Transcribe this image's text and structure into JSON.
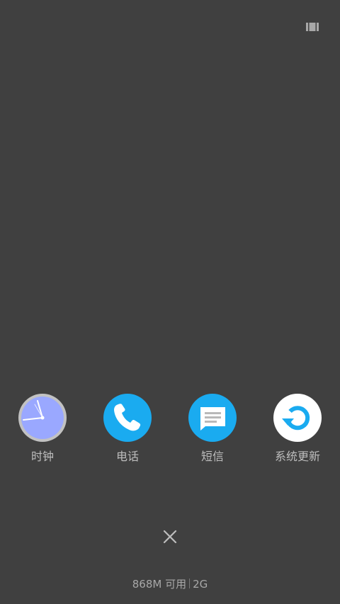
{
  "colors": {
    "background": "#404040",
    "label_text": "#bdbdbd",
    "blue_accent": "#1aabf0",
    "clock_face": "#9aa8ff",
    "clock_ring": "#c2c2c2"
  },
  "top_bar": {
    "view_toggle_icon": "view-toggle-icon"
  },
  "apps": [
    {
      "label": "时钟",
      "icon": "clock-icon"
    },
    {
      "label": "电话",
      "icon": "phone-icon"
    },
    {
      "label": "短信",
      "icon": "message-icon"
    },
    {
      "label": "系统更新",
      "icon": "system-update-icon"
    }
  ],
  "close_icon": "close-icon",
  "memory": {
    "available": "868M 可用",
    "total": "2G"
  }
}
